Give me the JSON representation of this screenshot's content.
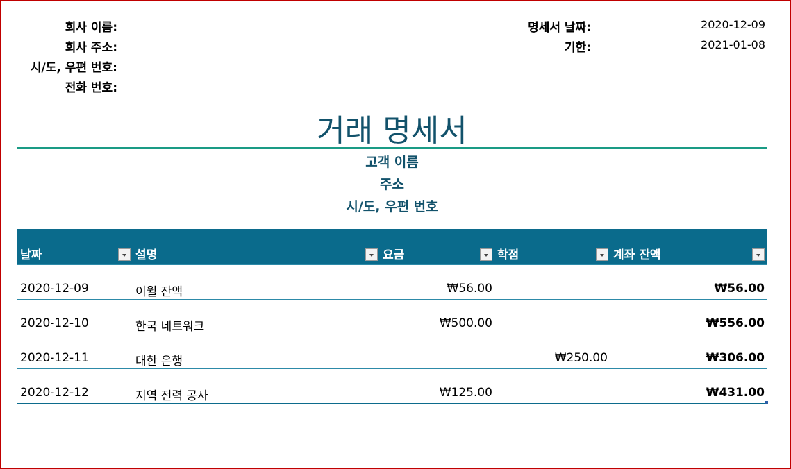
{
  "company": {
    "name_label": "회사 이름:",
    "address_label": "회사 주소:",
    "city_zip_label": "시/도, 우편 번호:",
    "phone_label": "전화 번호:"
  },
  "statement_info": {
    "date_label": "명세서 날짜:",
    "date_value": "2020-12-09",
    "due_label": "기한:",
    "due_value": "2021-01-08"
  },
  "title": "거래 명세서",
  "customer": {
    "name": "고객 이름",
    "address": "주소",
    "city_zip": "시/도, 우편 번호"
  },
  "table": {
    "columns": [
      "날짜",
      "설명",
      "요금",
      "학점",
      "계좌 잔액"
    ],
    "rows": [
      {
        "date": "2020-12-09",
        "description": "이월 잔액",
        "charge": "₩56.00",
        "credit": "",
        "balance": "₩56.00"
      },
      {
        "date": "2020-12-10",
        "description": "한국 네트워크",
        "charge": "₩500.00",
        "credit": "",
        "balance": "₩556.00"
      },
      {
        "date": "2020-12-11",
        "description": "대한 은행",
        "charge": "",
        "credit": "₩250.00",
        "balance": "₩306.00"
      },
      {
        "date": "2020-12-12",
        "description": "지역 전력 공사",
        "charge": "₩125.00",
        "credit": "",
        "balance": "₩431.00"
      }
    ]
  },
  "colors": {
    "title": "#12526b",
    "rule": "#1a9b85",
    "header_bg": "#0a6b8c",
    "frame": "#c00000"
  }
}
